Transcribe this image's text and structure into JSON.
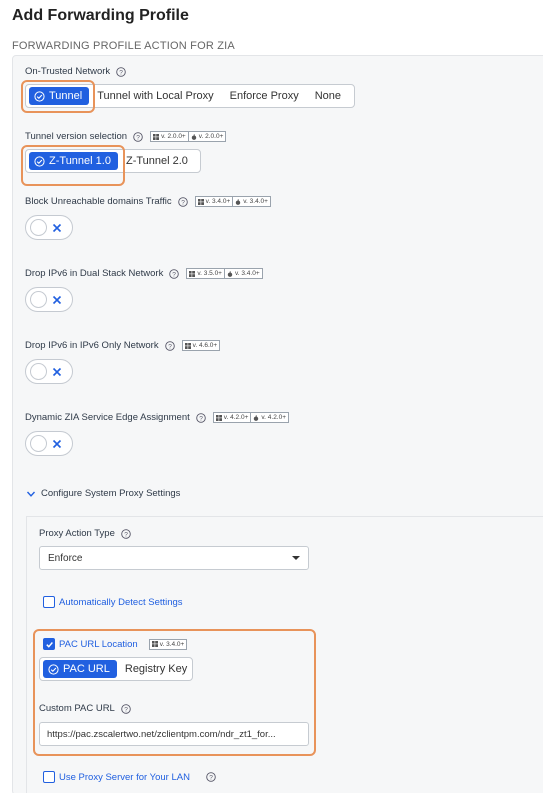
{
  "header": {
    "title": "Add Forwarding Profile",
    "section": "FORWARDING PROFILE ACTION FOR ZIA"
  },
  "on_trusted_network": {
    "label": "On-Trusted Network",
    "options": [
      "Tunnel",
      "Tunnel with Local Proxy",
      "Enforce Proxy",
      "None"
    ],
    "selected": "Tunnel"
  },
  "tunnel_version": {
    "label": "Tunnel version selection",
    "badges": [
      "v. 2.0.0+",
      "v. 2.0.0+"
    ],
    "options": [
      "Z-Tunnel 1.0",
      "Z-Tunnel 2.0"
    ],
    "selected": "Z-Tunnel 1.0"
  },
  "block_unreachable": {
    "label": "Block Unreachable domains Traffic",
    "badges": [
      "v. 3.4.0+",
      "v. 3.4.0+"
    ],
    "enabled": false
  },
  "drop_ipv6_dual": {
    "label": "Drop IPv6 in Dual Stack Network",
    "badges": [
      "v. 3.5.0+",
      "v. 3.4.0+"
    ],
    "enabled": false
  },
  "drop_ipv6_only": {
    "label": "Drop IPv6 in IPv6 Only Network",
    "badges": [
      "v. 4.6.0+"
    ],
    "enabled": false
  },
  "dynamic_zia": {
    "label": "Dynamic ZIA Service Edge Assignment",
    "badges": [
      "v. 4.2.0+",
      "v. 4.2.0+"
    ],
    "enabled": false
  },
  "system_proxy": {
    "label": "Configure System Proxy Settings",
    "proxy_action_label": "Proxy Action Type",
    "proxy_action_value": "Enforce",
    "auto_detect_label": "Automatically Detect Settings",
    "auto_detect_checked": false,
    "pac_url_location_label": "PAC URL Location",
    "pac_url_location_checked": true,
    "pac_badges": [
      "v. 3.4.0+"
    ],
    "pac_options": [
      "PAC URL",
      "Registry Key"
    ],
    "pac_selected": "PAC URL",
    "custom_pac_label": "Custom PAC URL",
    "custom_pac_value": "https://pac.zscalertwo.net/zclientpm.com/ndr_zt1_for...",
    "use_proxy_label": "Use Proxy Server for Your LAN",
    "use_proxy_checked": false
  },
  "colors": {
    "accent": "#2160e0",
    "highlight": "#e8935a"
  }
}
